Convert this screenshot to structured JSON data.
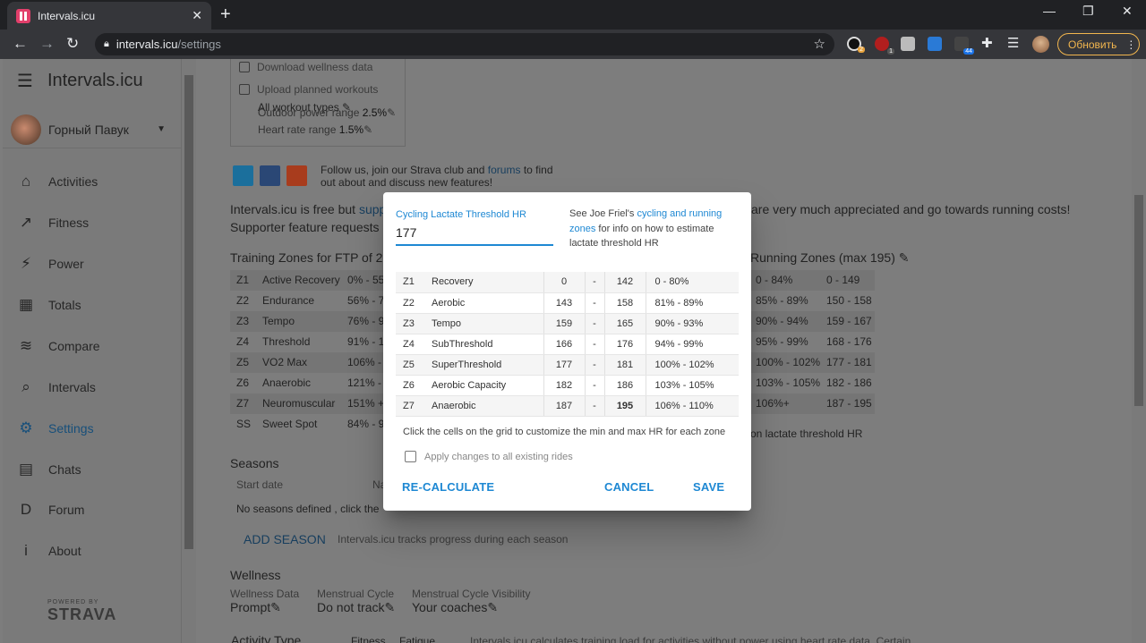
{
  "browser": {
    "tab_title": "Intervals.icu",
    "tab_close": "✕",
    "new_tab": "+",
    "win_min": "—",
    "win_max": "❐",
    "win_close": "✕",
    "url_host": "intervals.icu",
    "url_path": "/settings",
    "update_label": "Обновить",
    "ext_badges": [
      "2",
      "1",
      "44"
    ]
  },
  "sidebar": {
    "brand": "Intervals.icu",
    "user_name": "Горный Павук",
    "items": [
      {
        "label": "Activities",
        "icon": "home-icon",
        "glyph": "⌂"
      },
      {
        "label": "Fitness",
        "icon": "trend-icon",
        "glyph": "↗"
      },
      {
        "label": "Power",
        "icon": "power-icon",
        "glyph": "⚡"
      },
      {
        "label": "Totals",
        "icon": "totals-icon",
        "glyph": "▦"
      },
      {
        "label": "Compare",
        "icon": "compare-icon",
        "glyph": "≋"
      },
      {
        "label": "Intervals",
        "icon": "search-icon",
        "glyph": "⌕"
      },
      {
        "label": "Settings",
        "icon": "gear-icon",
        "glyph": "⚙"
      },
      {
        "label": "Chats",
        "icon": "chat-icon",
        "glyph": "▤"
      },
      {
        "label": "Forum",
        "icon": "forum-icon",
        "glyph": "D"
      },
      {
        "label": "About",
        "icon": "info-icon",
        "glyph": "i"
      }
    ],
    "strava_powered": "POWERED BY",
    "strava_name": "STRAVA"
  },
  "page": {
    "download_wellness": "Download wellness data",
    "upload_planned": "Upload planned workouts",
    "all_workout_types": "All workout types",
    "outdoor_power_range_label": "Outdoor power range",
    "outdoor_power_range_value": "2.5%",
    "hr_range_label": "Heart rate range",
    "hr_range_value": "1.5%",
    "follow_text_1": "Follow us, join our Strava club and",
    "forums_link": "forums",
    "follow_text_2": "to find",
    "follow_text_3": "out about and discuss new features!",
    "free_prefix": "Intervals.icu is free but",
    "free_link": "suppo",
    "free_suffix": "are very much appreciated and go towards running costs!",
    "supporter_text": "Supporter feature requests m",
    "training_zones_title": "Training Zones for FTP of 20",
    "running_zones_title": "Running Zones (max 195)",
    "power_zones": [
      {
        "z": "Z1",
        "name": "Active Recovery",
        "pct": "0% - 55%"
      },
      {
        "z": "Z2",
        "name": "Endurance",
        "pct": "56% - 75"
      },
      {
        "z": "Z3",
        "name": "Tempo",
        "pct": "76% - 90"
      },
      {
        "z": "Z4",
        "name": "Threshold",
        "pct": "91% - 10"
      },
      {
        "z": "Z5",
        "name": "VO2 Max",
        "pct": "106% - 1"
      },
      {
        "z": "Z6",
        "name": "Anaerobic",
        "pct": "121% -"
      },
      {
        "z": "Z7",
        "name": "Neuromuscular",
        "pct": "151% +"
      },
      {
        "z": "SS",
        "name": "Sweet Spot",
        "pct": "84% - 97"
      }
    ],
    "running_zones": [
      {
        "pct": "0 - 84%",
        "bpm": "0 - 149"
      },
      {
        "pct": "85% - 89%",
        "bpm": "150 - 158"
      },
      {
        "pct": "90% - 94%",
        "bpm": "159 - 167"
      },
      {
        "pct": "95% - 99%",
        "bpm": "168 - 176"
      },
      {
        "pct": "100% - 102%",
        "bpm": "177 - 181"
      },
      {
        "pct": "103% - 105%",
        "bpm": "182 - 186"
      },
      {
        "pct": "106%+",
        "bpm": "187 - 195"
      }
    ],
    "running_note": "on lactate threshold HR",
    "seasons_title": "Seasons",
    "start_date_header": "Start date",
    "name_header": "Na",
    "no_seasons": "No seasons defined , click the",
    "add_season_btn": "ADD SEASON",
    "seasons_hint": "Intervals.icu tracks progress during each season",
    "wellness_title": "Wellness",
    "wellness_data_label": "Wellness Data",
    "wellness_data_value": "Prompt",
    "menstrual_label": "Menstrual Cycle",
    "menstrual_value": "Do not track",
    "menstrual_vis_label": "Menstrual Cycle Visibility",
    "menstrual_vis_value": "Your coaches",
    "activity_type_header": "Activity Type",
    "fitness_header": "Fitness",
    "fatigue_header": "Fatigue",
    "activity_note": "Intervals.icu calculates training load for activities without power using heart rate data. Certain"
  },
  "modal": {
    "field_label": "Cycling Lactate Threshold HR",
    "field_value": "177",
    "help_prefix": "See Joe Friel's",
    "help_link": "cycling and running zones",
    "help_suffix": "for info on how to estimate lactate threshold HR",
    "zones": [
      {
        "z": "Z1",
        "name": "Recovery",
        "min": "0",
        "max": "142",
        "pct": "0 - 80%"
      },
      {
        "z": "Z2",
        "name": "Aerobic",
        "min": "143",
        "max": "158",
        "pct": "81% - 89%"
      },
      {
        "z": "Z3",
        "name": "Tempo",
        "min": "159",
        "max": "165",
        "pct": "90% - 93%"
      },
      {
        "z": "Z4",
        "name": "SubThreshold",
        "min": "166",
        "max": "176",
        "pct": "94% - 99%"
      },
      {
        "z": "Z5",
        "name": "SuperThreshold",
        "min": "177",
        "max": "181",
        "pct": "100% - 102%"
      },
      {
        "z": "Z6",
        "name": "Aerobic Capacity",
        "min": "182",
        "max": "186",
        "pct": "103% - 105%"
      },
      {
        "z": "Z7",
        "name": "Anaerobic",
        "min": "187",
        "max": "195",
        "pct": "106% - 110%"
      }
    ],
    "dash": "-",
    "note": "Click the cells on the grid to customize the min and max HR for each zone",
    "apply_label": "Apply changes to all existing rides",
    "recalc_btn": "RE-CALCULATE",
    "cancel_btn": "CANCEL",
    "save_btn": "SAVE"
  }
}
